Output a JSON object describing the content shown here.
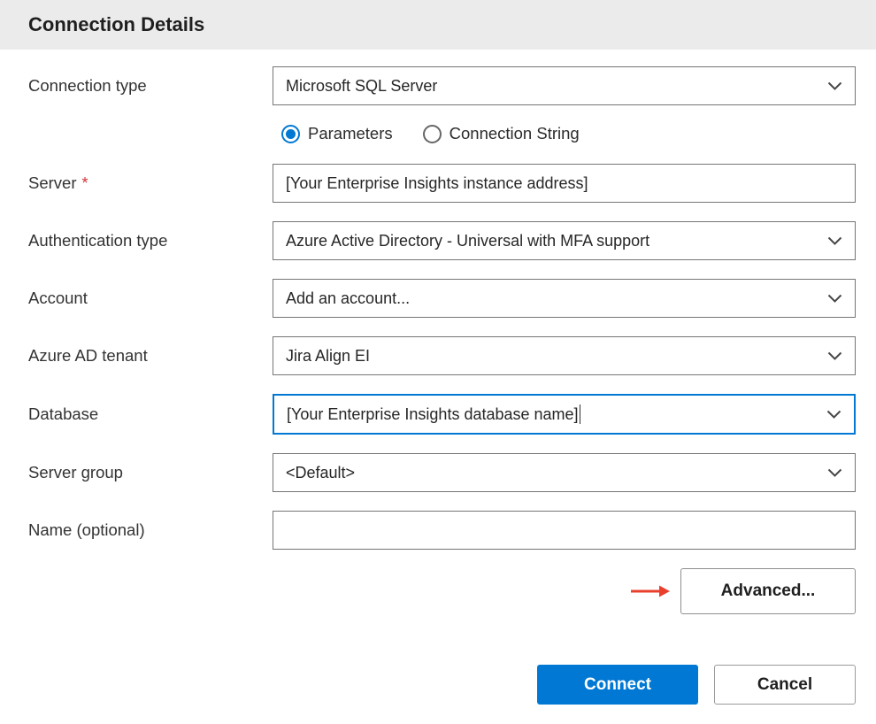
{
  "header": {
    "title": "Connection Details"
  },
  "form": {
    "connection_type": {
      "label": "Connection type",
      "value": "Microsoft SQL Server"
    },
    "mode": {
      "options": [
        {
          "label": "Parameters",
          "selected": true
        },
        {
          "label": "Connection String",
          "selected": false
        }
      ]
    },
    "server": {
      "label": "Server",
      "required_marker": "*",
      "value": "[Your Enterprise Insights instance address]"
    },
    "authentication_type": {
      "label": "Authentication type",
      "value": "Azure Active Directory - Universal with MFA support"
    },
    "account": {
      "label": "Account",
      "value": "Add an account..."
    },
    "azure_ad_tenant": {
      "label": "Azure AD tenant",
      "value": "Jira Align EI"
    },
    "database": {
      "label": "Database",
      "value": "[Your Enterprise Insights database name]"
    },
    "server_group": {
      "label": "Server group",
      "value": "<Default>"
    },
    "name": {
      "label": "Name (optional)",
      "value": ""
    }
  },
  "buttons": {
    "advanced": "Advanced...",
    "connect": "Connect",
    "cancel": "Cancel"
  },
  "colors": {
    "accent": "#0078d4",
    "required": "#d13438",
    "arrow": "#e8402c",
    "header_bg": "#ebebeb"
  }
}
